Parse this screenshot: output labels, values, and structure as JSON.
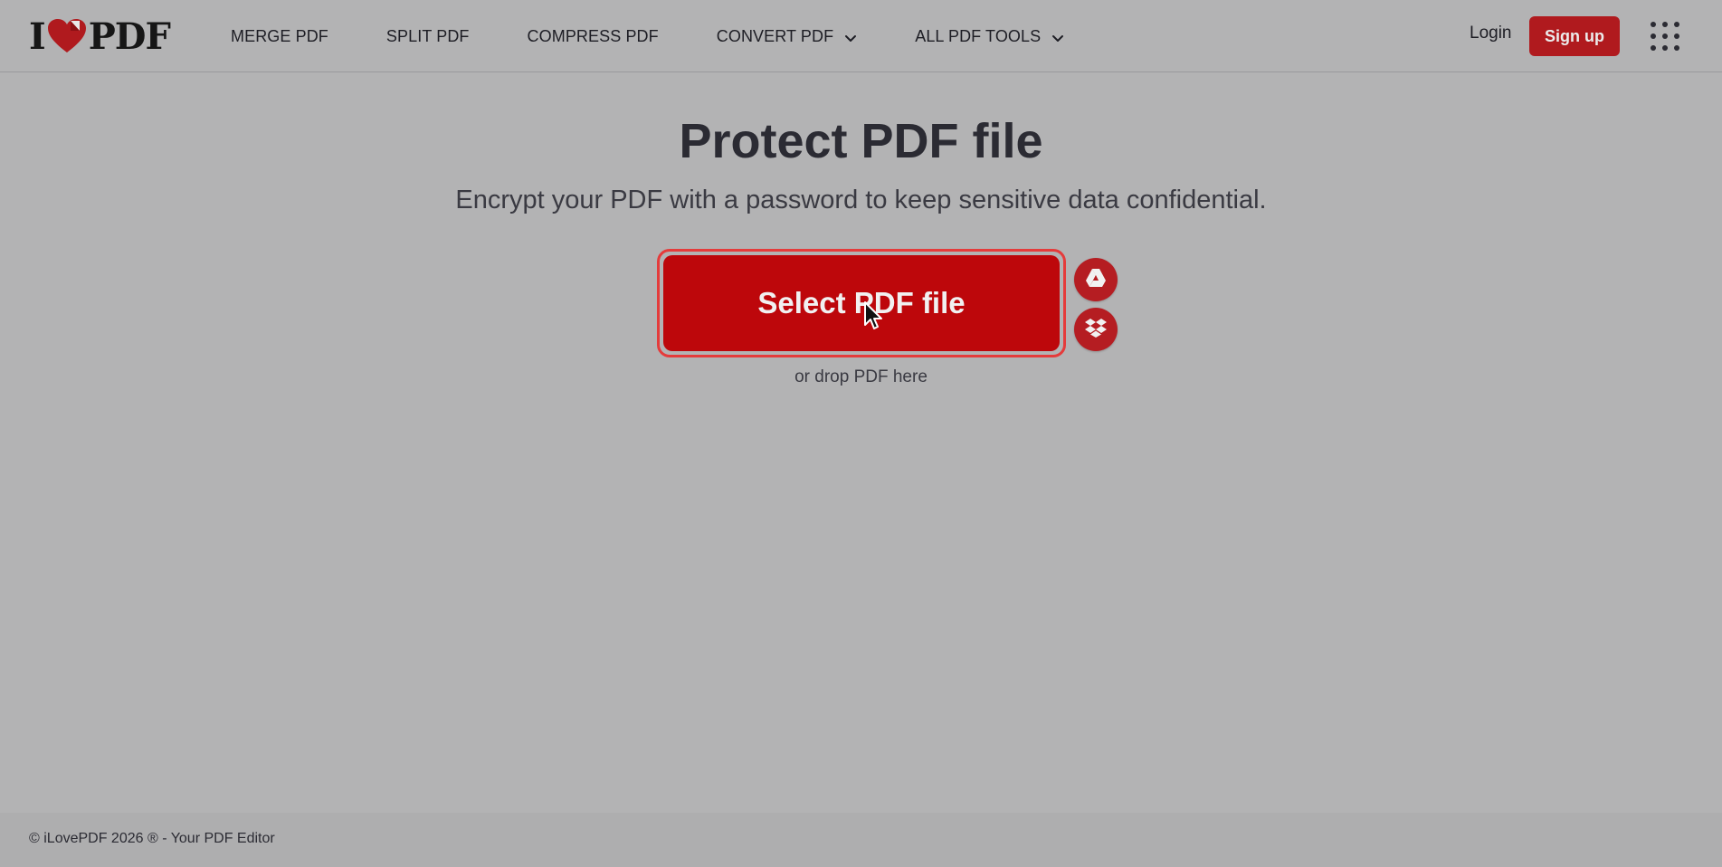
{
  "header": {
    "logo": {
      "text_before": "I",
      "text_after": "PDF",
      "icon": "heart-icon",
      "brand_color": "#b01a1e"
    },
    "nav": [
      {
        "label": "MERGE PDF",
        "has_dropdown": false
      },
      {
        "label": "SPLIT PDF",
        "has_dropdown": false
      },
      {
        "label": "COMPRESS PDF",
        "has_dropdown": false
      },
      {
        "label": "CONVERT PDF",
        "has_dropdown": true
      },
      {
        "label": "ALL PDF TOOLS",
        "has_dropdown": true
      }
    ],
    "login_label": "Login",
    "signup_label": "Sign up",
    "apps_icon": "grid-icon"
  },
  "main": {
    "title": "Protect PDF file",
    "subtitle": "Encrypt your PDF with a password to keep sensitive data confidential.",
    "select_label": "Select PDF file",
    "drop_hint": "or drop PDF here",
    "cloud_sources": [
      {
        "name": "Google Drive",
        "icon": "google-drive-icon"
      },
      {
        "name": "Dropbox",
        "icon": "dropbox-icon"
      }
    ],
    "accent_color": "#bd070b"
  },
  "footer": {
    "copyright": "© iLovePDF 2026 ® - Your PDF Editor"
  }
}
